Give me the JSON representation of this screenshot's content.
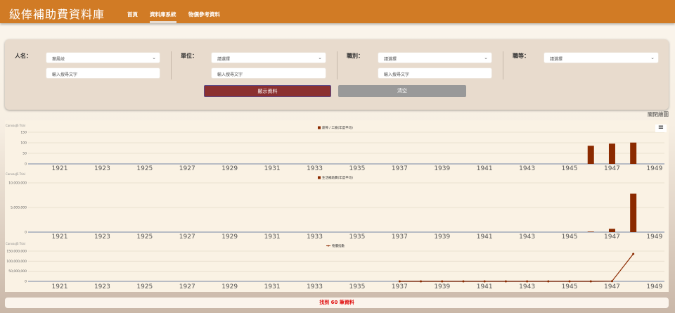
{
  "header": {
    "title": "級俸補助費資料庫",
    "nav": [
      "首頁",
      "資料庫系統",
      "物價參考資料"
    ]
  },
  "filters": {
    "name": {
      "label": "人名：",
      "value": "葉鳳岐",
      "placeholder": "輸入搜尋文字"
    },
    "unit": {
      "label": "單位：",
      "value": "請選擇",
      "placeholder": "輸入搜尋文字"
    },
    "job": {
      "label": "職別：",
      "value": "請選擇",
      "placeholder": "輸入搜尋文字"
    },
    "rank": {
      "label": "職等：",
      "value": "請選擇"
    },
    "show_button": "顯示資料",
    "clear_button": "清空"
  },
  "close_chart": "關閉繪圖",
  "result": "找到 60 筆資料",
  "colors": {
    "header": "#d17b25",
    "series": "#8b2a00",
    "show_button": "#8b3030",
    "clear_button": "#999999"
  },
  "chart_data": [
    {
      "type": "bar",
      "watermark": "CanvasJS Trial",
      "legend": "薪俸 / 工餉(年度平均)",
      "x_ticks": [
        1921,
        1923,
        1925,
        1927,
        1929,
        1931,
        1933,
        1935,
        1937,
        1939,
        1941,
        1943,
        1945,
        1947,
        1949
      ],
      "y_ticks": [
        "0",
        "50",
        "100",
        "150"
      ],
      "ylim": [
        0,
        150
      ],
      "x": [
        1946,
        1947,
        1948
      ],
      "values": [
        86,
        96,
        101
      ]
    },
    {
      "type": "bar",
      "watermark": "CanvasJS Trial",
      "legend": "生活補助費(年度平均)",
      "x_ticks": [
        1921,
        1923,
        1925,
        1927,
        1929,
        1931,
        1933,
        1935,
        1937,
        1939,
        1941,
        1943,
        1945,
        1947,
        1949
      ],
      "y_ticks": [
        "0",
        "5,000,000",
        "10,000,000"
      ],
      "ylim": [
        0,
        10000000
      ],
      "x": [
        1946,
        1947,
        1948
      ],
      "values": [
        100000,
        670000,
        7800000
      ]
    },
    {
      "type": "line",
      "watermark": "CanvasJS Trial",
      "legend": "物價指數",
      "x_ticks": [
        1921,
        1923,
        1925,
        1927,
        1929,
        1931,
        1933,
        1935,
        1937,
        1939,
        1941,
        1943,
        1945,
        1947,
        1949
      ],
      "y_ticks": [
        "0",
        "50,000,000",
        "100,000,000",
        "150,000,000"
      ],
      "ylim": [
        0,
        150000000
      ],
      "x": [
        1937,
        1938,
        1939,
        1940,
        1941,
        1942,
        1943,
        1944,
        1945,
        1946,
        1947,
        1948
      ],
      "values": [
        100,
        150,
        200,
        300,
        500,
        800,
        1200,
        2000,
        3000,
        100000,
        1000000,
        136000000
      ]
    }
  ]
}
